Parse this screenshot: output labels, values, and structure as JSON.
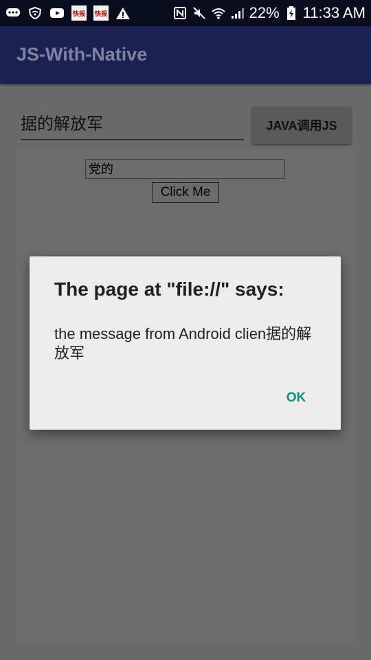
{
  "status_bar": {
    "battery_percent": "22%",
    "time": "11:33 AM",
    "tile_text": "快报"
  },
  "app_bar": {
    "title": "JS-With-Native"
  },
  "native": {
    "edit_value": "据的解放军",
    "java_button_label": "JAVA调用JS"
  },
  "webview": {
    "input_value": "党的",
    "click_button_label": "Click Me"
  },
  "dialog": {
    "title": "The page at \"file://\" says:",
    "message": "the message from Android clien据的解放军",
    "ok_label": "OK"
  },
  "colors": {
    "app_bar": "#1b2152",
    "accent": "#0c8d7d"
  }
}
